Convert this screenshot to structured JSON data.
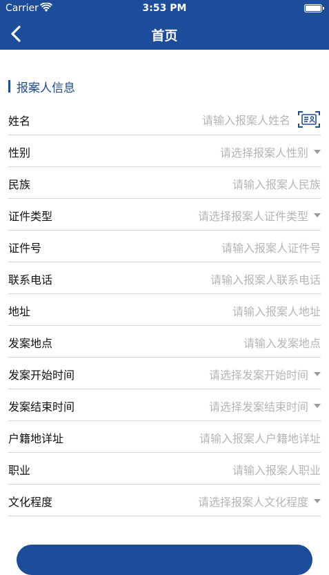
{
  "status_bar": {
    "carrier": "Carrier",
    "time": "3:53 PM",
    "battery_level": 1.0
  },
  "nav": {
    "title": "首页",
    "back_icon": "chevron-left-icon"
  },
  "section": {
    "title": "报案人信息"
  },
  "fields": [
    {
      "label": "姓名",
      "placeholder": "请输入报案人姓名",
      "type": "input",
      "icon": "id-card-scan-icon"
    },
    {
      "label": "性别",
      "placeholder": "请选择报案人性别",
      "type": "select"
    },
    {
      "label": "民族",
      "placeholder": "请输入报案人民族",
      "type": "input"
    },
    {
      "label": "证件类型",
      "placeholder": "请选择报案人证件类型",
      "type": "select"
    },
    {
      "label": "证件号",
      "placeholder": "请输入报案人证件号",
      "type": "input"
    },
    {
      "label": "联系电话",
      "placeholder": "请输入报案人联系电话",
      "type": "input"
    },
    {
      "label": "地址",
      "placeholder": "请输入报案人地址",
      "type": "input"
    },
    {
      "label": "发案地点",
      "placeholder": "请输入发案地点",
      "type": "input"
    },
    {
      "label": "发案开始时间",
      "placeholder": "请选择发案开始时间",
      "type": "select"
    },
    {
      "label": "发案结束时间",
      "placeholder": "请选择发案结束时间",
      "type": "select"
    },
    {
      "label": "户籍地详址",
      "placeholder": "请输入报案人户籍地详址",
      "type": "input"
    },
    {
      "label": "职业",
      "placeholder": "请输入报案人职业",
      "type": "input"
    },
    {
      "label": "文化程度",
      "placeholder": "请选择报案人文化程度",
      "type": "select"
    }
  ],
  "colors": {
    "brand": "#1d4c9a",
    "placeholder": "#b5b5b5",
    "divider": "#d5d5d5"
  }
}
